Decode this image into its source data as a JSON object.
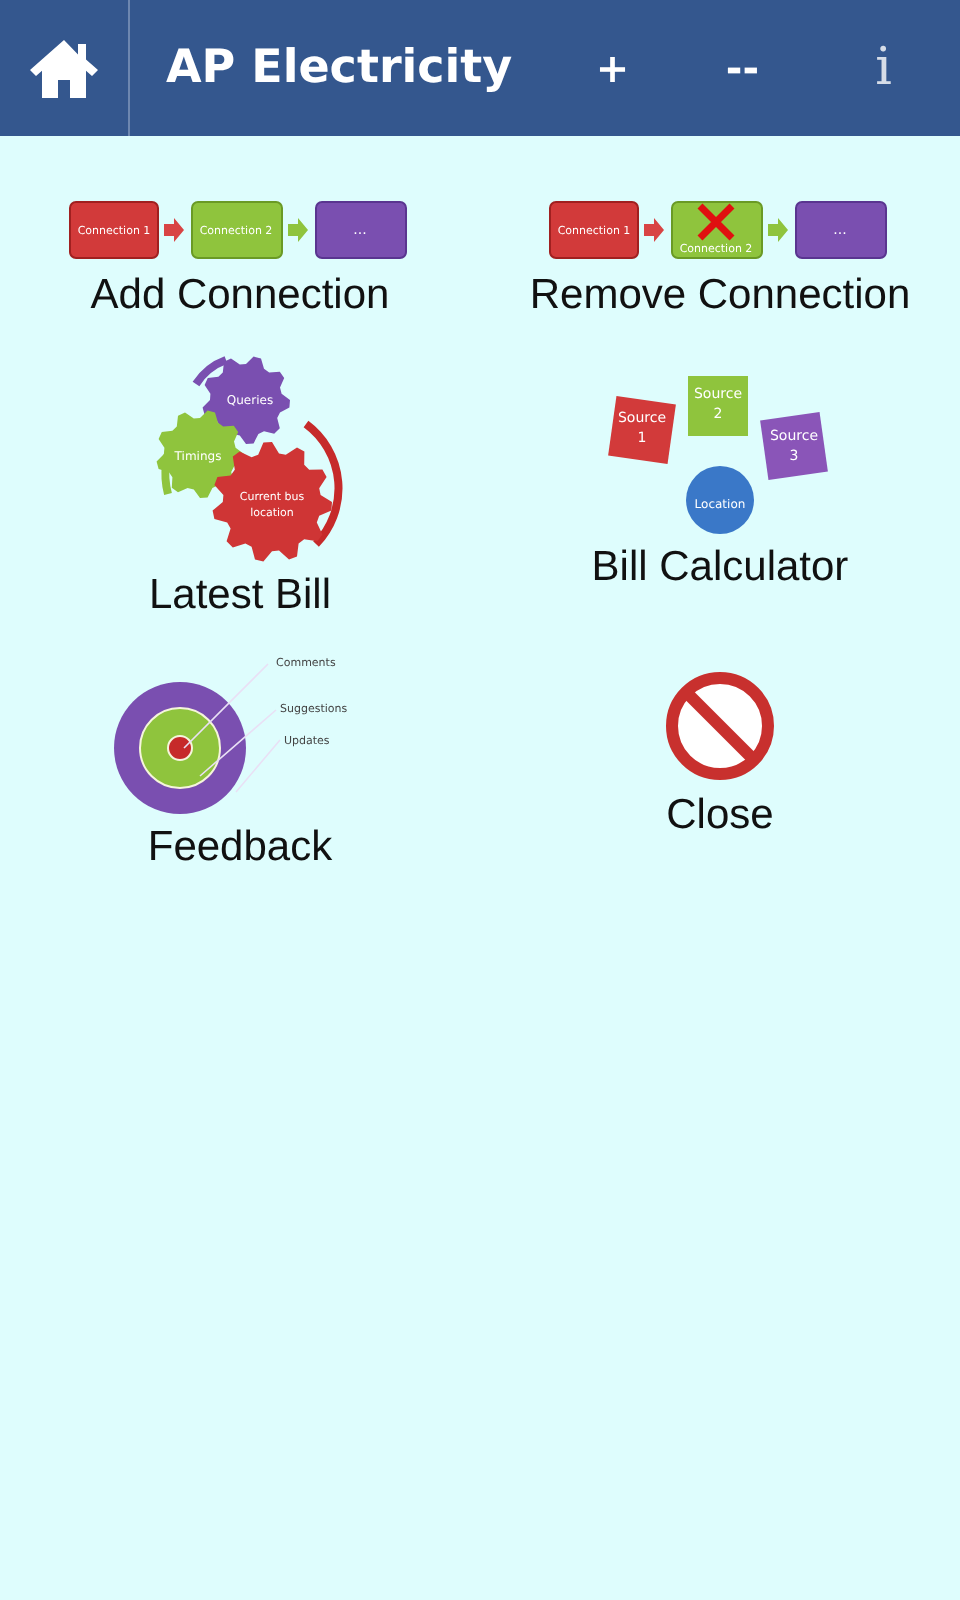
{
  "app_bar": {
    "title": "AP Electricity",
    "actions": [
      "+",
      "--",
      "i"
    ]
  },
  "tiles": [
    {
      "kind": "chain",
      "label": "Add Connection",
      "graphic_texts": [
        "Connection 1",
        "Connection 2",
        "..."
      ]
    },
    {
      "kind": "chain_removed",
      "label": "Remove Connection",
      "graphic_texts": [
        "Connection 1",
        "Connection 2",
        "..."
      ]
    },
    {
      "kind": "gears",
      "label": "Latest Bill",
      "graphic_texts": [
        "Queries",
        "Timings",
        "Current bus",
        "location"
      ]
    },
    {
      "kind": "sources",
      "label": "Bill Calculator",
      "graphic_texts": [
        "Source",
        "1",
        "Source",
        "2",
        "Source",
        "3",
        "Location"
      ]
    },
    {
      "kind": "target",
      "label": "Feedback",
      "graphic_texts": [
        "Comments",
        "Suggestions",
        "Updates"
      ]
    },
    {
      "kind": "close",
      "label": "Close"
    }
  ]
}
